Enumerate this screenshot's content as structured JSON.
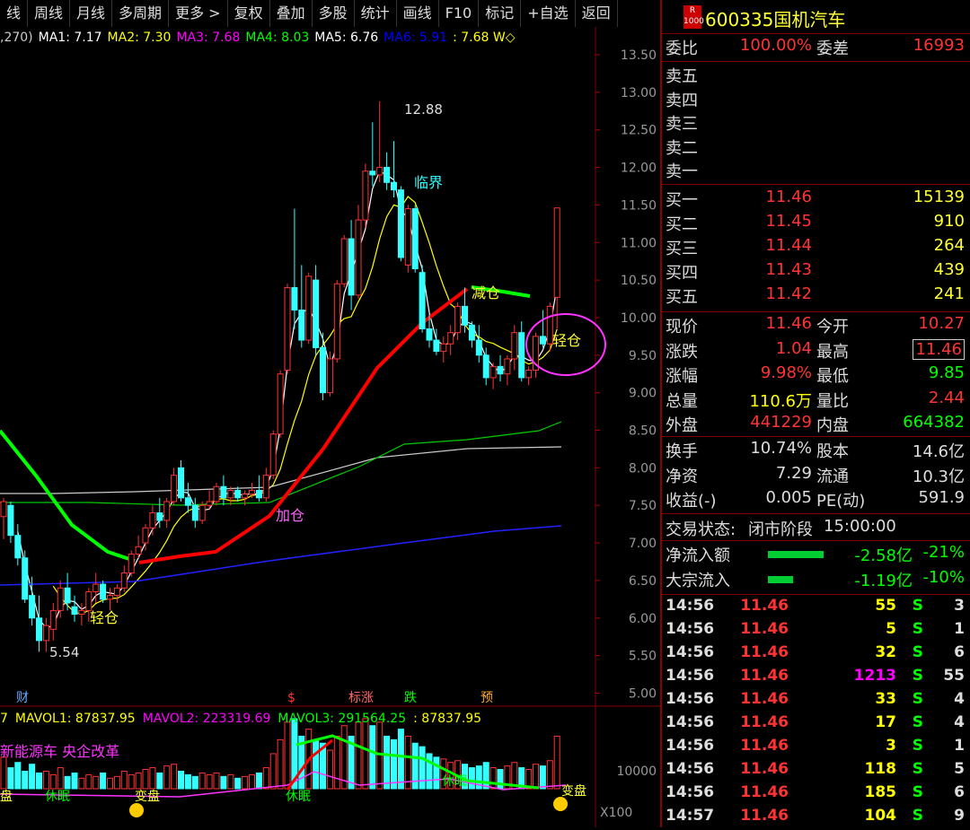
{
  "toolbar": {
    "items": [
      "线",
      "周线",
      "月线",
      "多周期",
      "更多 >",
      "复权",
      "叠加",
      "多股",
      "统计",
      "画线",
      "F10",
      "标记",
      "+自选",
      "返回"
    ]
  },
  "ma_legend": [
    {
      "label": ",270)",
      "color": "#cccccc"
    },
    {
      "label": "MA1: 7.17",
      "color": "#ffffff"
    },
    {
      "label": "MA2: 7.30",
      "color": "#ffff00"
    },
    {
      "label": "MA3: 7.68",
      "color": "#ff00ff"
    },
    {
      "label": "MA4: 8.03",
      "color": "#00ff00"
    },
    {
      "label": "MA5: 6.76",
      "color": "#ffffff"
    },
    {
      "label": "MA6: 5.91",
      "color": "#0000ff"
    },
    {
      "label": ": 7.68 W◇",
      "color": "#ffff00"
    }
  ],
  "price_axis": [
    "13.50",
    "13.00",
    "12.50",
    "12.00",
    "11.50",
    "11.00",
    "10.50",
    "10.00",
    "9.50",
    "9.00",
    "8.50",
    "8.00",
    "7.50",
    "7.00",
    "6.50",
    "6.00",
    "5.50",
    "5.00"
  ],
  "annotations": {
    "high": "12.88",
    "low": "5.54",
    "critical": "临界",
    "reduce": "减仓",
    "light1": "轻仓",
    "light2": "轻仓",
    "add": "加仓",
    "event_fin": "财",
    "event_s": "$",
    "event_limitup": "标涨",
    "event_down": "跌",
    "event_pre": "预",
    "sleep1": "休眠",
    "sleep2": "休眠",
    "sleep3": "休眠",
    "change1": "变盘",
    "change2": "变盘",
    "pan": "盘"
  },
  "vol_legend": [
    {
      "label": "7",
      "color": "#ffff00"
    },
    {
      "label": "MAVOL1: 87837.95",
      "color": "#ffff00"
    },
    {
      "label": "MAVOL2: 223319.69",
      "color": "#ff00ff"
    },
    {
      "label": "MAVOL3: 291564.25",
      "color": "#00ff00"
    },
    {
      "label": ": 87837.95",
      "color": "#ffff00"
    }
  ],
  "concept_tags": "新能源车 央企改革",
  "vol_axis": {
    "label": "10000",
    "scale": "X100"
  },
  "stock": {
    "badge_top": "R",
    "badge_bottom": "1000",
    "code": "600335",
    "name": "国机汽车"
  },
  "commission": {
    "ratio_label": "委比",
    "ratio": "100.00%",
    "diff_label": "委差",
    "diff": "16993"
  },
  "sell": [
    {
      "label": "卖五"
    },
    {
      "label": "卖四"
    },
    {
      "label": "卖三"
    },
    {
      "label": "卖二"
    },
    {
      "label": "卖一"
    }
  ],
  "buy": [
    {
      "label": "买一",
      "price": "11.46",
      "vol": "15139"
    },
    {
      "label": "买二",
      "price": "11.45",
      "vol": "910"
    },
    {
      "label": "买三",
      "price": "11.44",
      "vol": "264"
    },
    {
      "label": "买四",
      "price": "11.43",
      "vol": "439"
    },
    {
      "label": "买五",
      "price": "11.42",
      "vol": "241"
    }
  ],
  "stats": [
    {
      "l1": "现价",
      "v1": "11.46",
      "c1": "#ff3333",
      "l2": "今开",
      "v2": "10.27",
      "c2": "#ff3333"
    },
    {
      "l1": "涨跌",
      "v1": "1.04",
      "c1": "#ff3333",
      "l2": "最高",
      "v2": "11.46",
      "c2": "#ff3333"
    },
    {
      "l1": "涨幅",
      "v1": "9.98%",
      "c1": "#ff3333",
      "l2": "最低",
      "v2": "9.85",
      "c2": "#00ff00"
    },
    {
      "l1": "总量",
      "v1": "110.6万",
      "c1": "#ffff00",
      "l2": "量比",
      "v2": "2.44",
      "c2": "#ff3333"
    },
    {
      "l1": "外盘",
      "v1": "441229",
      "c1": "#ff3333",
      "l2": "内盘",
      "v2": "664382",
      "c2": "#00ff00"
    }
  ],
  "stats2": [
    {
      "l1": "换手",
      "v1": "10.74%",
      "l2": "股本",
      "v2": "14.6亿"
    },
    {
      "l1": "净资",
      "v1": "7.29",
      "l2": "流通",
      "v2": "10.3亿"
    },
    {
      "l1": "收益(-)",
      "v1": "0.005",
      "l2": "PE(动)",
      "v2": "591.9"
    }
  ],
  "trade_status": {
    "label": "交易状态:",
    "value": "闭市阶段",
    "time": "15:00:00"
  },
  "flows": [
    {
      "label": "净流入额",
      "bar_fraction": 0.78,
      "amount": "-2.58亿",
      "pct": "-21%"
    },
    {
      "label": "大宗流入",
      "bar_fraction": 0.35,
      "amount": "-1.19亿",
      "pct": "-10%"
    }
  ],
  "ticks": [
    {
      "time": "14:56",
      "price": "11.46",
      "vol": "55",
      "vc": "#ffff00",
      "side": "S",
      "n": "3"
    },
    {
      "time": "14:56",
      "price": "11.46",
      "vol": "5",
      "vc": "#ffff00",
      "side": "S",
      "n": "1"
    },
    {
      "time": "14:56",
      "price": "11.46",
      "vol": "32",
      "vc": "#ffff00",
      "side": "S",
      "n": "6"
    },
    {
      "time": "14:56",
      "price": "11.46",
      "vol": "1213",
      "vc": "#ff00ff",
      "side": "S",
      "n": "55"
    },
    {
      "time": "14:56",
      "price": "11.46",
      "vol": "33",
      "vc": "#ffff00",
      "side": "S",
      "n": "4"
    },
    {
      "time": "14:56",
      "price": "11.46",
      "vol": "17",
      "vc": "#ffff00",
      "side": "S",
      "n": "4"
    },
    {
      "time": "14:56",
      "price": "11.46",
      "vol": "3",
      "vc": "#ffff00",
      "side": "S",
      "n": "1"
    },
    {
      "time": "14:56",
      "price": "11.46",
      "vol": "118",
      "vc": "#ffff00",
      "side": "S",
      "n": "5"
    },
    {
      "time": "14:56",
      "price": "11.46",
      "vol": "185",
      "vc": "#ffff00",
      "side": "S",
      "n": "6"
    },
    {
      "time": "14:57",
      "price": "11.46",
      "vol": "104",
      "vc": "#ffff00",
      "side": "S",
      "n": "9"
    }
  ],
  "candles": [
    [
      7.35,
      7.6,
      7.05,
      7.55
    ],
    [
      7.5,
      7.55,
      7.0,
      7.1
    ],
    [
      7.1,
      7.25,
      6.7,
      6.8
    ],
    [
      6.8,
      6.9,
      6.2,
      6.25
    ],
    [
      6.3,
      6.55,
      5.9,
      6.0
    ],
    [
      6.0,
      6.3,
      5.55,
      5.7
    ],
    [
      5.7,
      6.0,
      5.55,
      5.9
    ],
    [
      5.85,
      6.2,
      5.7,
      6.1
    ],
    [
      6.1,
      6.5,
      6.0,
      6.4
    ],
    [
      6.4,
      6.6,
      6.1,
      6.2
    ],
    [
      6.15,
      6.3,
      5.95,
      6.05
    ],
    [
      6.05,
      6.2,
      5.9,
      6.1
    ],
    [
      6.1,
      6.4,
      5.95,
      6.35
    ],
    [
      6.35,
      6.6,
      6.2,
      6.45
    ],
    [
      6.45,
      6.5,
      6.2,
      6.25
    ],
    [
      6.25,
      6.4,
      6.1,
      6.3
    ],
    [
      6.3,
      6.45,
      6.2,
      6.4
    ],
    [
      6.4,
      6.7,
      6.35,
      6.6
    ],
    [
      6.6,
      6.9,
      6.55,
      6.85
    ],
    [
      6.85,
      7.1,
      6.8,
      6.95
    ],
    [
      7.0,
      7.25,
      6.9,
      7.2
    ],
    [
      7.2,
      7.5,
      7.1,
      7.4
    ],
    [
      7.4,
      7.6,
      7.2,
      7.3
    ],
    [
      7.3,
      7.6,
      7.2,
      7.55
    ],
    [
      7.55,
      8.0,
      7.5,
      7.9
    ],
    [
      8.0,
      8.1,
      7.55,
      7.6
    ],
    [
      7.6,
      7.8,
      7.4,
      7.5
    ],
    [
      7.5,
      7.6,
      7.2,
      7.3
    ],
    [
      7.3,
      7.55,
      7.25,
      7.5
    ],
    [
      7.5,
      7.7,
      7.45,
      7.55
    ],
    [
      7.55,
      7.8,
      7.5,
      7.75
    ],
    [
      7.75,
      7.9,
      7.5,
      7.6
    ],
    [
      7.6,
      7.75,
      7.5,
      7.7
    ],
    [
      7.7,
      7.75,
      7.55,
      7.6
    ],
    [
      7.6,
      7.7,
      7.5,
      7.65
    ],
    [
      7.65,
      7.8,
      7.6,
      7.7
    ],
    [
      7.7,
      7.9,
      7.55,
      7.6
    ],
    [
      7.6,
      8.0,
      7.55,
      7.9
    ],
    [
      7.9,
      8.5,
      7.85,
      8.45
    ],
    [
      8.45,
      9.3,
      8.4,
      9.25
    ],
    [
      9.3,
      10.45,
      9.25,
      10.4
    ],
    [
      10.4,
      11.45,
      9.85,
      10.1
    ],
    [
      10.1,
      10.7,
      9.6,
      9.7
    ],
    [
      9.7,
      10.6,
      9.65,
      10.55
    ],
    [
      10.5,
      10.7,
      9.5,
      9.6
    ],
    [
      9.6,
      9.8,
      8.9,
      9.0
    ],
    [
      9.0,
      9.55,
      8.95,
      9.45
    ],
    [
      9.45,
      10.5,
      9.4,
      10.45
    ],
    [
      10.45,
      11.1,
      10.4,
      11.05
    ],
    [
      11.05,
      11.3,
      10.1,
      10.3
    ],
    [
      10.3,
      11.5,
      10.25,
      11.3
    ],
    [
      11.3,
      12.05,
      11.2,
      11.95
    ],
    [
      11.95,
      12.6,
      11.75,
      11.9
    ],
    [
      11.9,
      12.88,
      11.8,
      12.0
    ],
    [
      12.0,
      12.2,
      11.7,
      11.8
    ],
    [
      11.8,
      12.35,
      11.6,
      11.7
    ],
    [
      11.7,
      11.75,
      10.75,
      10.8
    ],
    [
      10.7,
      11.5,
      10.6,
      11.45
    ],
    [
      11.45,
      11.5,
      10.6,
      10.65
    ],
    [
      10.6,
      10.7,
      9.8,
      9.85
    ],
    [
      9.85,
      10.05,
      9.6,
      9.7
    ],
    [
      9.7,
      9.85,
      9.5,
      9.55
    ],
    [
      9.55,
      9.75,
      9.4,
      9.65
    ],
    [
      9.65,
      9.9,
      9.5,
      9.8
    ],
    [
      9.8,
      10.2,
      9.7,
      10.15
    ],
    [
      10.15,
      10.4,
      9.8,
      9.9
    ],
    [
      9.9,
      9.95,
      9.6,
      9.7
    ],
    [
      9.7,
      9.9,
      9.4,
      9.5
    ],
    [
      9.5,
      9.6,
      9.1,
      9.2
    ],
    [
      9.2,
      9.4,
      9.05,
      9.35
    ],
    [
      9.35,
      9.5,
      9.15,
      9.25
    ],
    [
      9.25,
      9.5,
      9.1,
      9.45
    ],
    [
      9.45,
      9.9,
      9.3,
      9.8
    ],
    [
      9.8,
      9.95,
      9.15,
      9.2
    ],
    [
      9.2,
      9.35,
      9.1,
      9.3
    ],
    [
      9.3,
      9.8,
      9.2,
      9.75
    ],
    [
      9.75,
      10.1,
      9.6,
      9.65
    ],
    [
      9.65,
      10.2,
      9.55,
      10.15
    ],
    [
      10.27,
      11.46,
      9.85,
      11.46
    ]
  ],
  "volumes": [
    18,
    12,
    15,
    10,
    14,
    9,
    10,
    8,
    12,
    7,
    9,
    6,
    8,
    7,
    9,
    6,
    7,
    10,
    8,
    9,
    11,
    12,
    9,
    13,
    14,
    10,
    8,
    7,
    9,
    8,
    9,
    7,
    8,
    6,
    7,
    8,
    9,
    12,
    20,
    28,
    38,
    40,
    30,
    34,
    28,
    26,
    22,
    30,
    36,
    30,
    38,
    40,
    36,
    38,
    30,
    28,
    34,
    30,
    26,
    24,
    20,
    18,
    17,
    15,
    16,
    14,
    12,
    13,
    15,
    12,
    11,
    13,
    15,
    12,
    11,
    14,
    13,
    16,
    30
  ]
}
